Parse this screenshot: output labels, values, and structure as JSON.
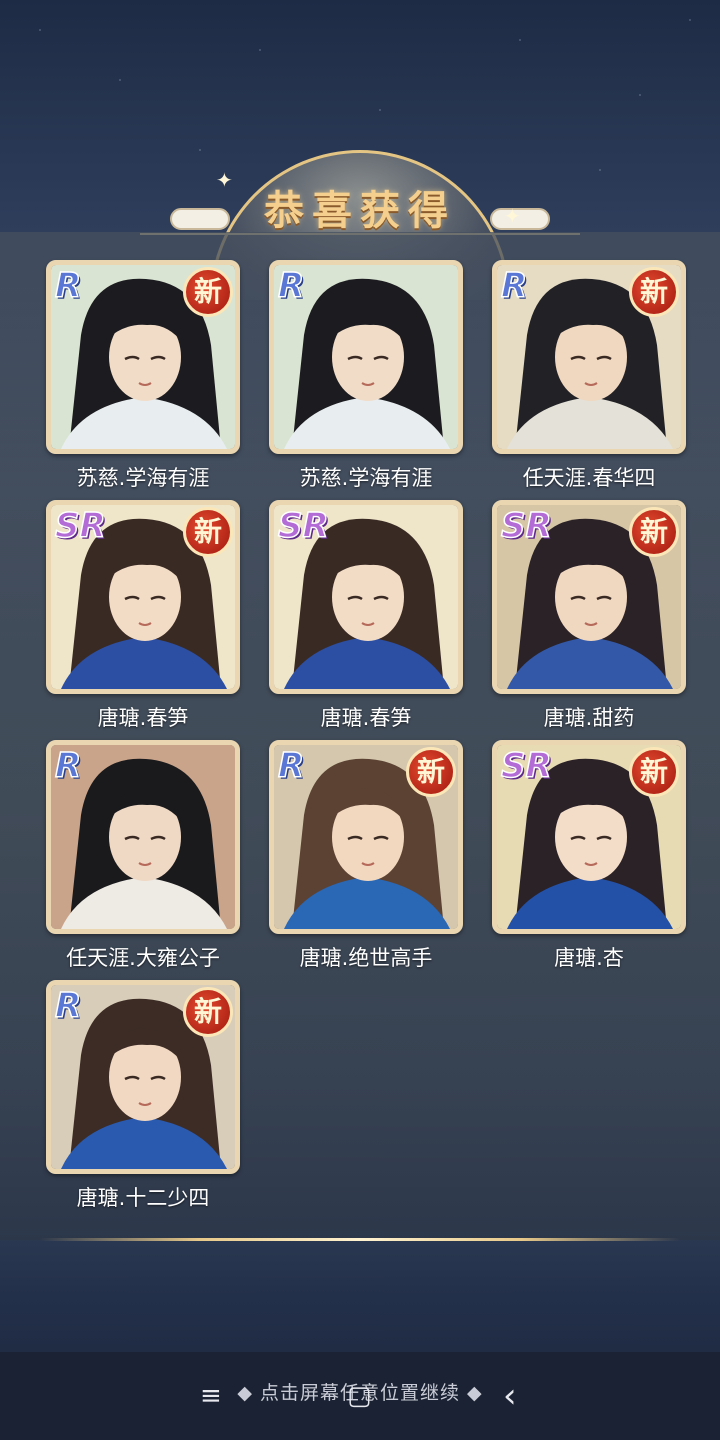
{
  "title": "恭喜获得",
  "cards": [
    {
      "rarity": "R",
      "name": "苏慈.学海有涯",
      "new": true,
      "palette": {
        "bg": "#d9e4d2",
        "hair": "#1c1c20",
        "robe": "#e8eef0",
        "skin": "#f1dcc8"
      }
    },
    {
      "rarity": "R",
      "name": "苏慈.学海有涯",
      "new": false,
      "palette": {
        "bg": "#d9e4d2",
        "hair": "#1c1c20",
        "robe": "#e8eef0",
        "skin": "#f1dcc8"
      }
    },
    {
      "rarity": "R",
      "name": "任天涯.春华四",
      "new": true,
      "palette": {
        "bg": "#e6dcc4",
        "hair": "#222226",
        "robe": "#e4e1d8",
        "skin": "#f0d7bf"
      }
    },
    {
      "rarity": "SR",
      "name": "唐瑭.春笋",
      "new": true,
      "palette": {
        "bg": "#efe6c9",
        "hair": "#3a2a24",
        "robe": "#2c4fa4",
        "skin": "#f3dcc6"
      }
    },
    {
      "rarity": "SR",
      "name": "唐瑭.春笋",
      "new": false,
      "palette": {
        "bg": "#efe6c9",
        "hair": "#3a2a24",
        "robe": "#2c4fa4",
        "skin": "#f3dcc6"
      }
    },
    {
      "rarity": "SR",
      "name": "唐瑭.甜药",
      "new": true,
      "palette": {
        "bg": "#d6c6a6",
        "hair": "#2a2226",
        "robe": "#3358a8",
        "skin": "#f0d7c0"
      }
    },
    {
      "rarity": "R",
      "name": "任天涯.大雍公子",
      "new": false,
      "palette": {
        "bg": "#c9a48a",
        "hair": "#1a1a1d",
        "robe": "#eeeae4",
        "skin": "#efd8c4"
      }
    },
    {
      "rarity": "R",
      "name": "唐瑭.绝世高手",
      "new": true,
      "palette": {
        "bg": "#d4c7ad",
        "hair": "#5b4233",
        "robe": "#2a67b5",
        "skin": "#f2d8bf"
      }
    },
    {
      "rarity": "SR",
      "name": "唐瑭.杏",
      "new": true,
      "palette": {
        "bg": "#e7dbb3",
        "hair": "#2b2228",
        "robe": "#2451a8",
        "skin": "#f3dcc8"
      }
    },
    {
      "rarity": "R",
      "name": "唐瑭.十二少四",
      "new": true,
      "palette": {
        "bg": "#d8cdb8",
        "hair": "#3d2c26",
        "robe": "#2a5ab0",
        "skin": "#f1d8c2"
      }
    }
  ],
  "new_label": "新",
  "footer": {
    "hint": "◆ 点击屏幕任意位置继续 ◆"
  },
  "navbar": {
    "menu_icon": "≡",
    "home_icon": "▢",
    "back_icon": "‹"
  }
}
